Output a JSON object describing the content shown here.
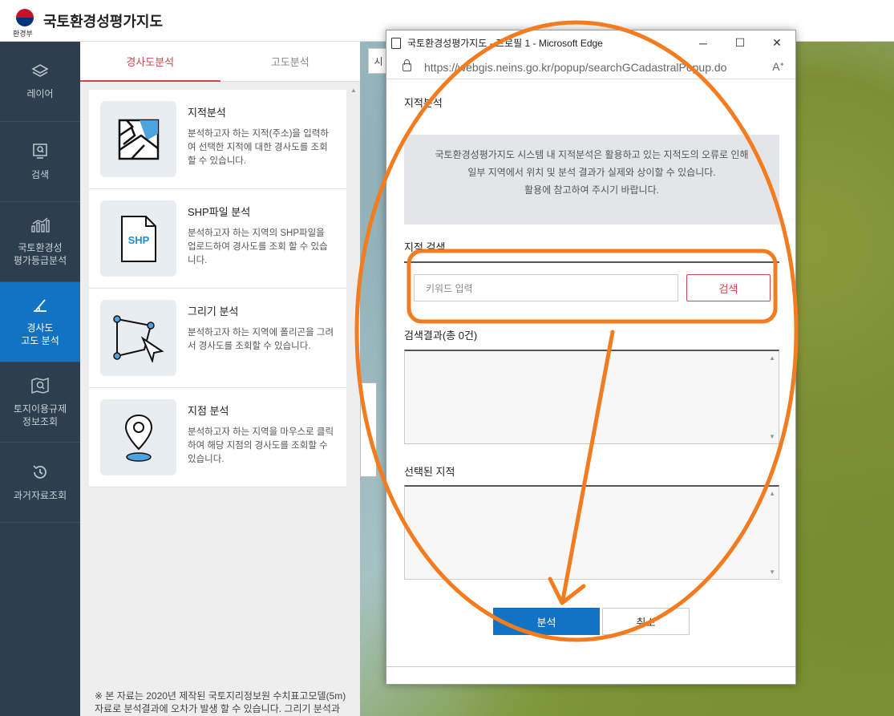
{
  "header": {
    "title": "국토환경성평가지도",
    "ministry": "환경부"
  },
  "nav": [
    {
      "id": "layer",
      "label": "레이어",
      "icon": "layers-icon",
      "active": false
    },
    {
      "id": "search",
      "label": "검색",
      "icon": "search-icon",
      "active": false
    },
    {
      "id": "grade",
      "label": "국토환경성\n평가등급분석",
      "icon": "bar-chart-icon",
      "active": false
    },
    {
      "id": "slope",
      "label": "경사도\n고도 분석",
      "icon": "slope-icon",
      "active": true
    },
    {
      "id": "land",
      "label": "토지이용규제\n정보조회",
      "icon": "map-search-icon",
      "active": false
    },
    {
      "id": "history",
      "label": "과거자료조회",
      "icon": "history-icon",
      "active": false
    }
  ],
  "panel": {
    "tabs": [
      {
        "label": "경사도분석",
        "active": true
      },
      {
        "label": "고도분석",
        "active": false
      }
    ],
    "cards": [
      {
        "title": "지적분석",
        "desc": "분석하고자 하는 지적(주소)을 입력하여 선택한 지적에 대한 경사도를 조회할 수 있습니다.",
        "icon": "cadastral-map-icon"
      },
      {
        "title": "SHP파일 분석",
        "desc": "분석하고자 하는 지역의 SHP파일을 업로드하여 경사도를 조회 할 수 있습니다.",
        "icon": "shp-file-icon",
        "icon_text": "SHP"
      },
      {
        "title": "그리기 분석",
        "desc": "분석하고자 하는 지역에 폴리곤을 그려서 경사도를 조회할 수 있습니다.",
        "icon": "polygon-draw-icon"
      },
      {
        "title": "지점 분석",
        "desc": "분석하고자 하는 지역을 마우스로 클릭하여 해당 지점의 경사도를 조회할 수 있습니다.",
        "icon": "location-pin-icon"
      }
    ],
    "note": "※ 본 자료는 2020년 제작된 국토지리정보원 수치표고모델(5m) 자료로 분석결과에 오차가 발생 할 수 있습니다. 그리기 분석과"
  },
  "map": {
    "search_stub": "시"
  },
  "popup": {
    "window_title": "국토환경성평가지도 - 프로필 1 - Microsoft Edge",
    "url": "https://webgis.neins.go.kr/popup/searchGCadastralPopup.do",
    "read_aloud": "A",
    "section_title": "지적분석",
    "notice_lines": [
      "국토환경성평가지도 시스템 내 지적분석은 활용하고 있는 지적도의 오류로 인해",
      "일부 지역에서 위치 및 분석 결과가 실제와 상이할 수 있습니다.",
      "활용에 참고하여 주시기 바랍니다."
    ],
    "search_title": "지적 검색",
    "keyword_placeholder": "키워드 입력",
    "search_button": "검색",
    "results_title": "검색결과(총 0건)",
    "selected_title": "선택된 지적",
    "run_button": "분석",
    "cancel_button": "취소"
  },
  "colors": {
    "accent_red": "#d2454a",
    "primary_blue": "#1272c4",
    "nav_bg": "#2d3e4e",
    "annotation_orange": "#f47c20"
  }
}
